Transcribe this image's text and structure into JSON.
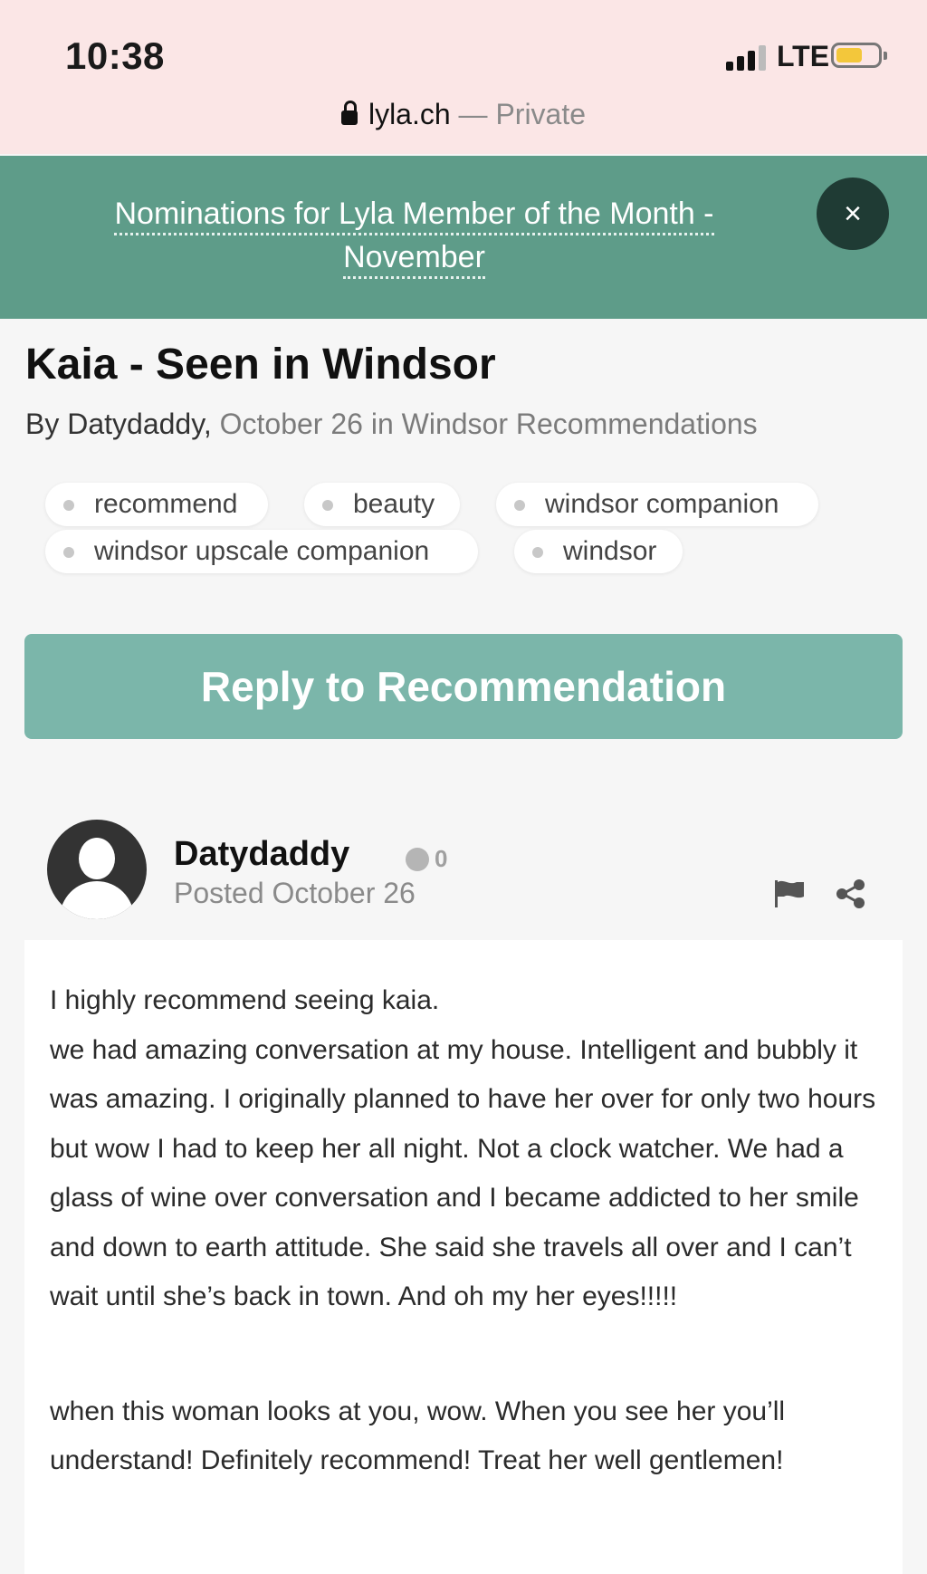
{
  "status_bar": {
    "time": "10:38",
    "network": "LTE"
  },
  "url_bar": {
    "domain": "lyla.ch",
    "separator": " — ",
    "mode": "Private"
  },
  "banner": {
    "line1": "Nominations for Lyla Member of the Month -",
    "line2": "November",
    "close_label": "×"
  },
  "topic": {
    "title": "Kaia - Seen in Windsor",
    "byline_prefix": "By Datydaddy,",
    "byline_meta": " October 26 in Windsor Recommendations"
  },
  "tags": [
    "recommend",
    "beauty",
    "windsor companion",
    "windsor upscale companion",
    "windsor"
  ],
  "reply_button": "Reply to Recommendation",
  "post": {
    "author": "Datydaddy",
    "reputation": "0",
    "posted": "Posted October 26",
    "paragraph1": "I highly recommend seeing kaia.\nwe had amazing conversation at my house. Intelligent and bubbly it was amazing. I originally planned to have her over for only two hours but wow I had to keep her all night. Not a clock watcher. We had a glass of wine over conversation and I became addicted to her smile and down to earth attitude. She said she travels all over and I can’t wait until she’s back in town. And oh my her eyes!!!!!",
    "paragraph2": "when this woman looks at you, wow. When you see her you’ll understand! Definitely recommend! Treat her well gentlemen!"
  },
  "colors": {
    "status_bg": "#fbe6e6",
    "banner_bg": "#5e9c89",
    "close_bg": "#1f3b34",
    "reply_bg": "#7bb6aa",
    "battery": "#f3c73b"
  },
  "icons": [
    "lock-icon",
    "signal-icon",
    "battery-icon",
    "close-icon",
    "flag-icon",
    "share-icon",
    "avatar-placeholder-icon"
  ]
}
